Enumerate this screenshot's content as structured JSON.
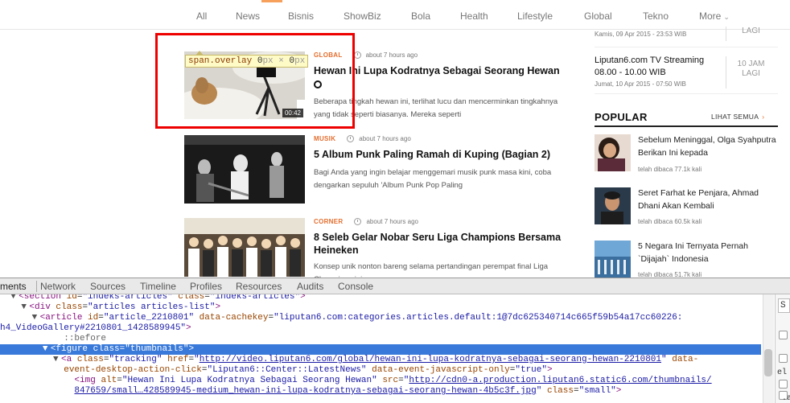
{
  "nav": {
    "items": [
      "All",
      "News",
      "Bisnis",
      "ShowBiz",
      "Bola",
      "Health",
      "Lifestyle",
      "Global",
      "Tekno",
      "More"
    ]
  },
  "overlay_tooltip": {
    "tag": "span.overlay",
    "w": "0",
    "px": "px",
    "x": "×",
    "h": "0"
  },
  "articles": [
    {
      "category": "GLOBAL",
      "time": "about 7 hours ago",
      "title": "Hewan Ini Lupa Kodratnya Sebagai Seorang Hewan",
      "desc": "Beberapa tingkah hewan ini, terlihat lucu dan mencerminkan tingkahnya yang tidak seperti biasanya. Mereka seperti",
      "duration": "00:42"
    },
    {
      "category": "MUSIK",
      "time": "about 7 hours ago",
      "title": "5 Album Punk Paling Ramah di Kuping (Bagian 2)",
      "desc": "Bagi Anda yang ingin belajar menggemari musik punk masa kini, coba dengarkan sepuluh 'Album Punk Pop Paling"
    },
    {
      "category": "CORNER",
      "time": "about 7 hours ago",
      "title": "8 Seleb Gelar Nobar Seru Liga Champions Bersama Heineken",
      "desc": "Konsep unik nonton bareng selama pertandingan perempat final Liga Champions ini ..."
    }
  ],
  "sidebar": {
    "live": [
      {
        "title": "",
        "sub": "Kamis, 09 Apr 2015 - 23:53 WIB",
        "badge": "LAGI"
      },
      {
        "title": "Liputan6.com TV Streaming",
        "title2": "08.00 - 10.00 WIB",
        "sub": "Jumat, 10 Apr 2015 - 07:50 WIB",
        "badge1": "10 JAM",
        "badge2": "LAGI"
      }
    ],
    "popular_heading": "POPULAR",
    "popular_more": "LIHAT SEMUA",
    "popular": [
      {
        "title": "Sebelum Meninggal, Olga Syahputra Berikan Ini kepada",
        "sub": "telah dibaca 77.1k kali"
      },
      {
        "title": "Seret Farhat ke Penjara, Ahmad Dhani Akan Kembali",
        "sub": "telah dibaca 60.5k kali"
      },
      {
        "title": "5 Negara Ini Ternyata Pernah `Dijajah` Indonesia",
        "sub": "telah dibaca 51.7k kali"
      }
    ]
  },
  "devtools": {
    "tabs": [
      "ments",
      "Network",
      "Sources",
      "Timeline",
      "Profiles",
      "Resources",
      "Audits",
      "Console"
    ],
    "side": {
      "input": "S",
      "el": "el",
      "dot_a": ".a"
    }
  }
}
